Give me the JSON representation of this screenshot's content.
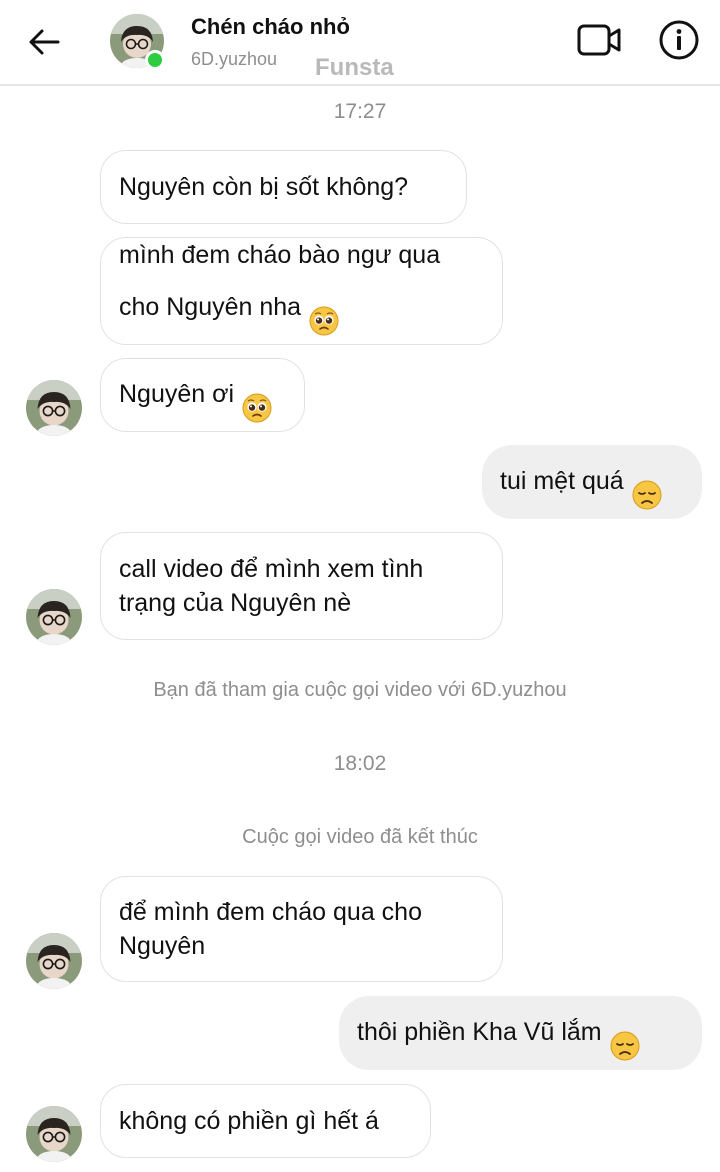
{
  "header": {
    "contact_name": "Chén cháo nhỏ",
    "username": "6D.yuzhou",
    "watermark": "Funsta"
  },
  "thread": {
    "time1": "17:27",
    "msg1": "Nguyên còn bị sốt không?",
    "msg2": "mình đem cháo bào ngư qua\ncho Nguyên nha",
    "msg3": "Nguyên ơi",
    "msg4": "tui mệt quá",
    "msg5": "call video để mình xem tình\ntrạng của Nguyên nè",
    "system1": "Bạn đã tham gia cuộc gọi video với 6D.yuzhou",
    "time2": "18:02",
    "system2": "Cuộc gọi video đã kết thúc",
    "msg6": "để mình đem cháo qua cho\nNguyên",
    "msg7": "thôi phiền Kha Vũ lắm",
    "msg8": "không có phiền gì hết á"
  },
  "icons": {
    "back": "arrow-left-icon",
    "video": "video-camera-icon",
    "info": "info-circle-icon",
    "pleading": "pleading-face-emoji",
    "disappointed": "disappointed-face-emoji"
  },
  "colors": {
    "online": "#2ecc40",
    "outgoing_bubble": "#efefef",
    "incoming_border": "#e2e2e2",
    "meta_text": "#8e8e8e"
  }
}
